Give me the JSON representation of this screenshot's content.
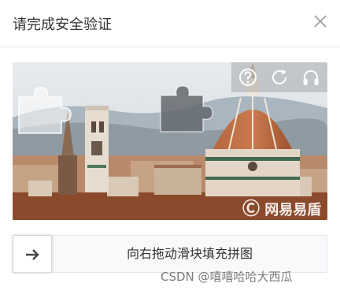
{
  "dialog": {
    "title": "请完成安全验证"
  },
  "icons": {
    "close": "close-icon",
    "help": "help-icon",
    "refresh": "refresh-icon",
    "audio": "headphones-icon",
    "arrow": "arrow-right-icon"
  },
  "captcha": {
    "watermark": "网易易盾"
  },
  "slider": {
    "hint": "向右拖动滑块填充拼图"
  },
  "footer": {
    "credit": "CSDN @嘻嘻哈哈大西瓜"
  },
  "colors": {
    "title": "#333333",
    "slider_bg": "#f7f9fa",
    "slider_border": "#e4e7eb",
    "credit": "#7a7a7a"
  }
}
